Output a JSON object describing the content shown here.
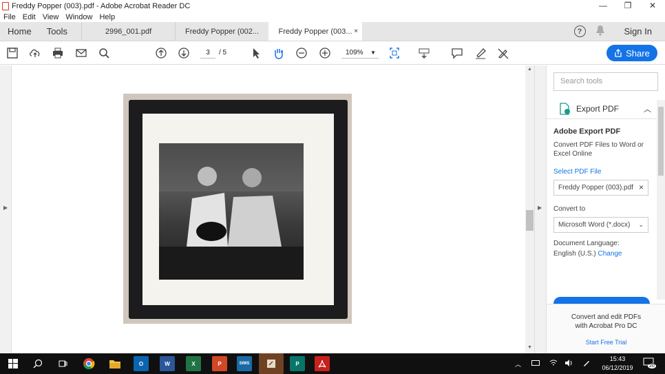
{
  "window": {
    "title": "Freddy Popper (003).pdf - Adobe Acrobat Reader DC",
    "minimize": "—",
    "restore": "❐",
    "close": "✕"
  },
  "menu": [
    "File",
    "Edit",
    "View",
    "Window",
    "Help"
  ],
  "tabs": {
    "home": "Home",
    "tools": "Tools",
    "docs": [
      {
        "label": "2996_001.pdf"
      },
      {
        "label": "Freddy Popper (002..."
      },
      {
        "label": "Freddy Popper (003...",
        "close": "×"
      }
    ],
    "help": "?",
    "sign_in": "Sign In"
  },
  "toolbar": {
    "page_current": "3",
    "page_total": "/ 5",
    "zoom": "109%",
    "share": "Share"
  },
  "tools_pane": {
    "search_placeholder": "Search tools",
    "export_title": "Export PDF",
    "heading": "Adobe Export PDF",
    "description": "Convert PDF Files to Word or Excel Online",
    "select_file": "Select PDF File",
    "file_name": "Freddy Popper (003).pdf",
    "convert_to": "Convert to",
    "format": "Microsoft Word (*.docx)",
    "doc_language_label": "Document Language:",
    "language": "English (U.S.)",
    "change": "Change",
    "promo_text": "Convert and edit PDFs with Acrobat Pro DC",
    "promo_link": "Start Free Trial"
  },
  "taskbar": {
    "apps": [
      "start",
      "search",
      "task-view",
      "chrome",
      "file-explorer",
      "outlook",
      "word",
      "excel",
      "powerpoint",
      "sims",
      "notes",
      "publisher",
      "acrobat"
    ],
    "sims_label": "SIMS",
    "time": "15:43",
    "date": "06/12/2019",
    "notifications": "20"
  },
  "colors": {
    "accent": "#1473e6",
    "taskbar": "#101010",
    "frame": "#1c1c1e"
  }
}
